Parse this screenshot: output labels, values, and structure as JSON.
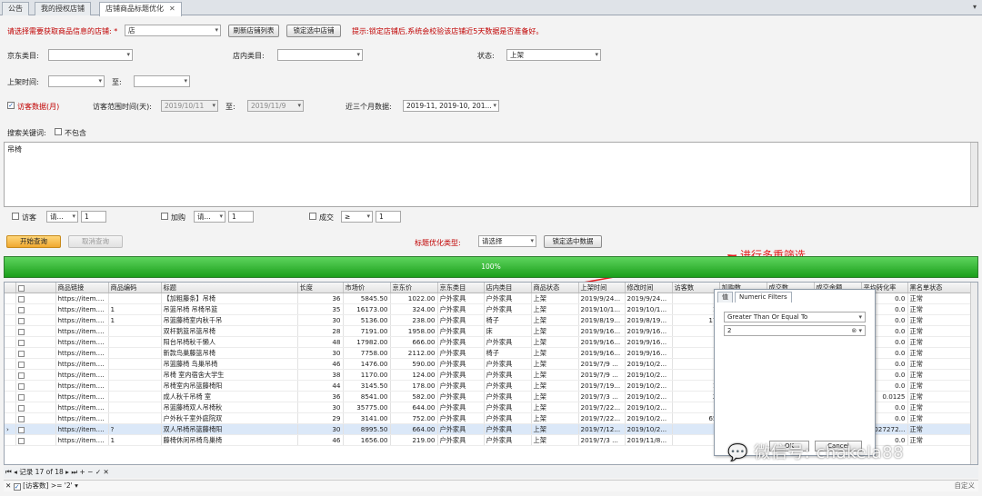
{
  "tabs": [
    {
      "label": "公告"
    },
    {
      "label": "我的授权店铺"
    },
    {
      "label": "店铺商品标题优化"
    }
  ],
  "form": {
    "shop_label": "请选择需要获取商品信息的店铺: *",
    "shop_value": "店",
    "refresh_button": "刷新店铺列表",
    "lock_button": "锁定选中店铺",
    "hint": "提示:锁定店铺后,系统会校验该店铺近5天数据是否准备好。",
    "jd_category_label": "京东类目:",
    "store_category_label": "店内类目:",
    "status_label": "状态:",
    "status_value": "上架",
    "listing_time_label": "上架时间:",
    "to_label": "至:",
    "visitor_data_label": "访客数据(月)",
    "visit_range_label": "访客范围时间(天):",
    "visit_from": "2019/10/11",
    "visit_to": "2019/11/9",
    "recent_label": "近三个月数据:",
    "recent_value": "2019-11, 2019-10, 201...",
    "keyword_label": "搜索关键词:",
    "exclude_label": "不包含",
    "keyword_text": "吊椅"
  },
  "filters_row": {
    "visitor_label": "访客",
    "visitor_op": "请...",
    "visitor_val": "1",
    "cart_label": "加购",
    "cart_op": "请...",
    "cart_val": "1",
    "deal_label": "成交",
    "deal_op": "≥",
    "deal_val": "1"
  },
  "actions": {
    "start_button": "开始查询",
    "cancel_button": "取消查询",
    "opt_type_label": "标题优化类型:",
    "opt_type_value": "请选择",
    "lock_data_button": "锁定选中数据"
  },
  "progress": {
    "label": "100%",
    "value": 1.0
  },
  "annotation": "进行多重筛选",
  "table": {
    "headers": [
      "商品链接",
      "商品编码",
      "标题",
      "长度",
      "市场价",
      "京东价",
      "京东类目",
      "店内类目",
      "商品状态",
      "上架时间",
      "修改时间",
      "访客数",
      "加购数",
      "成交数",
      "成交金额",
      "平均转化率",
      "黑名单状态"
    ],
    "rows": [
      {
        "link": "https://item....",
        "code": "",
        "title": "【加粗藤条】吊椅",
        "len": "36",
        "mkt": "5845.50",
        "jd": "1022.00",
        "jdcat": "户外家具",
        "cat": "户外家具",
        "st": "上架",
        "on": "2019/9/24...",
        "mod": "2019/9/24...",
        "vis": "",
        "cart": "",
        "rate": "0.0",
        "bl": "正常"
      },
      {
        "link": "https://item....",
        "code": "1",
        "title": "吊篮吊椅 吊椅吊篮",
        "len": "35",
        "mkt": "16173.00",
        "jd": "324.00",
        "jdcat": "户外家具",
        "cat": "户外家具",
        "st": "上架",
        "on": "2019/10/1...",
        "mod": "2019/10/1...",
        "vis": "1",
        "cart": "",
        "rate": "0.0",
        "bl": "正常"
      },
      {
        "link": "https://item....",
        "code": "1",
        "title": "吊篮藤椅室内秋千吊",
        "len": "30",
        "mkt": "5136.00",
        "jd": "238.00",
        "jdcat": "户外家具",
        "cat": "椅子",
        "st": "上架",
        "on": "2019/8/19...",
        "mod": "2019/8/19...",
        "vis": "17",
        "cart": "",
        "rate": "0.0",
        "bl": "正常"
      },
      {
        "link": "https://item....",
        "code": "",
        "title": "双杆鹅篮吊篮吊椅",
        "len": "28",
        "mkt": "7191.00",
        "jd": "1958.00",
        "jdcat": "户外家具",
        "cat": "床",
        "st": "上架",
        "on": "2019/9/16...",
        "mod": "2019/9/16...",
        "vis": "",
        "cart": "",
        "rate": "0.0",
        "bl": "正常"
      },
      {
        "link": "https://item....",
        "code": "",
        "title": "阳台吊椅秋千懒人",
        "len": "48",
        "mkt": "17982.00",
        "jd": "666.00",
        "jdcat": "户外家具",
        "cat": "户外家具",
        "st": "上架",
        "on": "2019/9/16...",
        "mod": "2019/9/16...",
        "vis": "",
        "cart": "",
        "rate": "0.0",
        "bl": "正常"
      },
      {
        "link": "https://item....",
        "code": "",
        "title": "新款鸟巢藤篮吊椅",
        "len": "30",
        "mkt": "7758.00",
        "jd": "2112.00",
        "jdcat": "户外家具",
        "cat": "椅子",
        "st": "上架",
        "on": "2019/9/16...",
        "mod": "2019/9/16...",
        "vis": "",
        "cart": "",
        "rate": "0.0",
        "bl": "正常"
      },
      {
        "link": "https://item....",
        "code": "",
        "title": "吊篮藤椅 鸟巢吊椅",
        "len": "46",
        "mkt": "1476.00",
        "jd": "590.00",
        "jdcat": "户外家具",
        "cat": "户外家具",
        "st": "上架",
        "on": "2019/7/9 ...",
        "mod": "2019/10/2...",
        "vis": "",
        "cart": "",
        "rate": "0.0",
        "bl": "正常"
      },
      {
        "link": "https://item....",
        "code": "",
        "title": "吊椅 室内宿舍大学生",
        "len": "38",
        "mkt": "1170.00",
        "jd": "124.00",
        "jdcat": "户外家具",
        "cat": "户外家具",
        "st": "上架",
        "on": "2019/7/9 ...",
        "mod": "2019/10/2...",
        "vis": "",
        "cart": "",
        "rate": "0.0",
        "bl": "正常"
      },
      {
        "link": "https://item....",
        "code": "",
        "title": "吊椅室内吊篮藤椅阳",
        "len": "44",
        "mkt": "3145.50",
        "jd": "178.00",
        "jdcat": "户外家具",
        "cat": "户外家具",
        "st": "上架",
        "on": "2019/7/19...",
        "mod": "2019/10/2...",
        "vis": "1",
        "cart": "",
        "rate": "0.0",
        "bl": "正常"
      },
      {
        "link": "https://item....",
        "code": "",
        "title": "成人秋千吊椅 室",
        "len": "36",
        "mkt": "8541.00",
        "jd": "582.00",
        "jdcat": "户外家具",
        "cat": "户外家具",
        "st": "上架",
        "on": "2019/7/3 ...",
        "mod": "2019/10/2...",
        "vis": "2",
        "cart": "",
        "rate": "0.0125",
        "bl": "正常"
      },
      {
        "link": "https://item....",
        "code": "",
        "title": "吊篮藤椅双人吊椅秋",
        "len": "30",
        "mkt": "35775.00",
        "jd": "644.00",
        "jdcat": "户外家具",
        "cat": "户外家具",
        "st": "上架",
        "on": "2019/7/22...",
        "mod": "2019/10/2...",
        "vis": "",
        "cart": "",
        "rate": "0.0",
        "bl": "正常"
      },
      {
        "link": "https://item....",
        "code": "",
        "title": "户外秋千室外庭院双",
        "len": "29",
        "mkt": "3141.00",
        "jd": "752.00",
        "jdcat": "户外家具",
        "cat": "户外家具",
        "st": "上架",
        "on": "2019/7/22...",
        "mod": "2019/10/2...",
        "vis": "65",
        "cart": "",
        "rate": "0.0",
        "bl": "正常"
      },
      {
        "link": "https://item....",
        "code": "?",
        "title": "双人吊椅吊篮藤椅阳",
        "len": "30",
        "mkt": "8995.50",
        "jd": "664.00",
        "jdcat": "户外家具",
        "cat": "户外家具",
        "st": "上架",
        "on": "2019/7/12...",
        "mod": "2019/10/2...",
        "vis": "?",
        "cart": "",
        "rate": "0.027272...",
        "bl": "正常"
      },
      {
        "link": "https://item....",
        "code": "1",
        "title": "藤椅休闲吊椅鸟巢椅",
        "len": "46",
        "mkt": "1656.00",
        "jd": "219.00",
        "jdcat": "户外家具",
        "cat": "户外家具",
        "st": "上架",
        "on": "2019/7/3 ...",
        "mod": "2019/11/8...",
        "vis": "",
        "cart": "",
        "rate": "0.0",
        "bl": "正常"
      }
    ]
  },
  "filter_popup": {
    "tab_values": "值",
    "tab_numeric": "Numeric Filters",
    "operator": "Greater Than Or Equal To",
    "value": "2",
    "ok": "OK",
    "cancel": "Cancel"
  },
  "navbar": {
    "record": "记录 17 of 18"
  },
  "statusbar": {
    "filter_text": "[访客数] >= '2'",
    "customize": "自定义"
  },
  "watermark": "微信号: chakela88"
}
